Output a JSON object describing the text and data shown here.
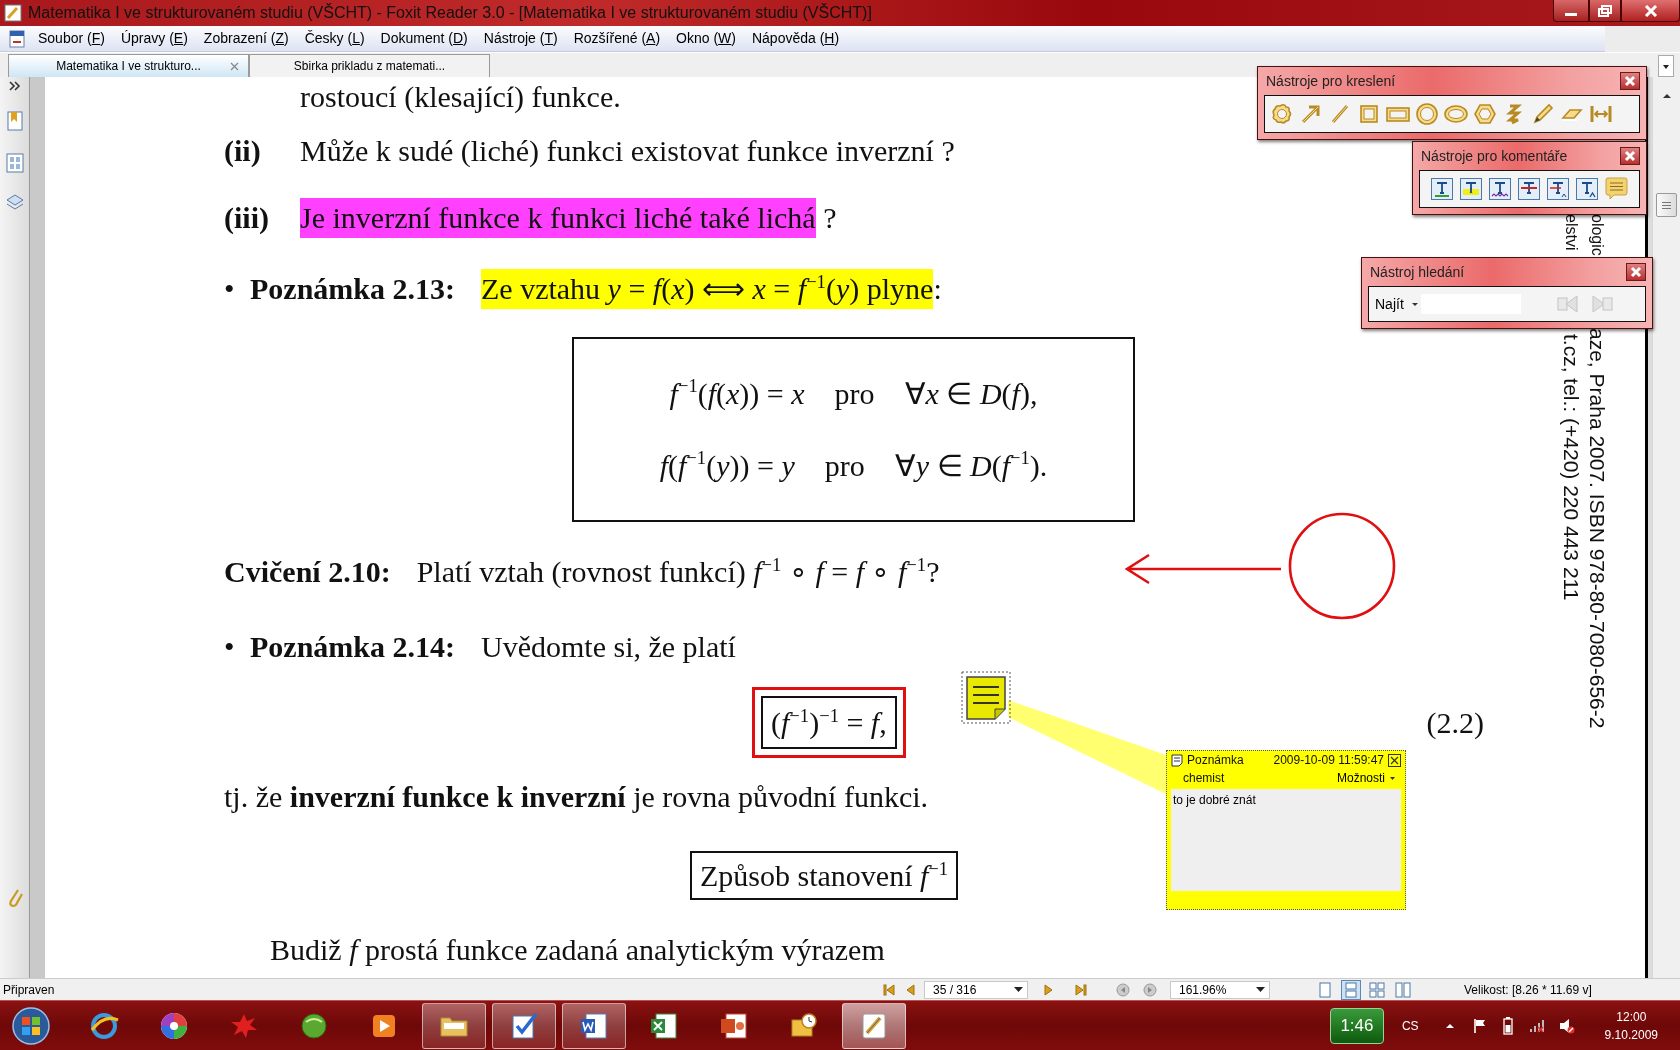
{
  "window": {
    "title": "Matematika I ve strukturovaném studiu (VŠCHT) - Foxit Reader 3.0 - [Matematika I ve strukturovaném studiu (VŠCHT)]"
  },
  "menu": [
    {
      "before": "Soubor (",
      "key": "F",
      "after": ")"
    },
    {
      "before": "Úpravy (",
      "key": "E",
      "after": ")"
    },
    {
      "before": "Zobrazení (",
      "key": "Z",
      "after": ")"
    },
    {
      "before": "Česky (",
      "key": "L",
      "after": ")"
    },
    {
      "before": "Dokument (",
      "key": "D",
      "after": ")"
    },
    {
      "before": "Nástroje (",
      "key": "T",
      "after": ")"
    },
    {
      "before": "Rozšířené (",
      "key": "A",
      "after": ")"
    },
    {
      "before": "Okno (",
      "key": "W",
      "after": ")"
    },
    {
      "before": "Nápověda (",
      "key": "H",
      "after": ")"
    }
  ],
  "tabs": [
    {
      "label": "Matematika I ve strukturo...",
      "selected": true
    },
    {
      "label": "Sbirka prikladu z matemati...",
      "selected": false
    }
  ],
  "document": {
    "cut_line": "rostoucí (klesající) funkce.",
    "questions": [
      {
        "label": "(ii)",
        "segments": [
          {
            "text": "Může k sudé (liché) funkci existovat funkce inverzní ?"
          }
        ]
      },
      {
        "label": "(iii)",
        "segments": [
          {
            "text": "Je inverzní funkce k funkci liché také lichá",
            "color": "#ff40ff"
          },
          {
            "text": " ?"
          }
        ]
      }
    ],
    "remark_1": {
      "bullet": "•",
      "title": "Poznámka 2.13:",
      "segments": [
        {
          "text": "Ze vztahu *y* = *f*(*x*) ⟺ *x* = *f*$^{−1}$(*y*) plyne",
          "color": "#ffff00"
        },
        {
          "text": ":"
        }
      ]
    },
    "formula_box": [
      {
        "lhs": "*f*$^{−1}$(*f*(*x*)) = *x*",
        "word": "pro",
        "rhs": "∀*x* ∈ *D*(*f*),"
      },
      {
        "lhs": "*f*(*f*$^{−1}$(*y*)) = *y*",
        "word": "pro",
        "rhs": "∀*y* ∈ *D*(*f*$^{−1}$)."
      }
    ],
    "exercise": {
      "title": "Cvičení 2.10:",
      "text": "Platí vztah (rovnost funkcí) *f*$^{−1}$ ∘ *f* = *f* ∘ *f*$^{−1}$?"
    },
    "remark_2": {
      "bullet": "•",
      "title": "Poznámka 2.14:",
      "text": "Uvědomte si, že platí"
    },
    "equation": {
      "formula": "(*f*$^{−1}$)$^{−1}$ = *f*,",
      "number": "(2.2)"
    },
    "sentence": "tj. že **inverzní funkce k inverzní** je rovna původní funkci.",
    "heading": "Způsob stanovení *f*$^{−1}$",
    "last_line": "Budiž *f* prostá funkce zadaná analytickým výrazem",
    "side_text": [
      {
        "parts": [
          "elstvi",
          "t.cz, tel.: (+420) 220 443 211"
        ]
      },
      {
        "parts": [
          "ologic",
          "aze, Praha 2007. ISBN 978-80-7080-656-2"
        ]
      }
    ]
  },
  "note": {
    "title": "Poznámka",
    "date": "2009-10-09 11:59:47",
    "author": "chemist",
    "options": "Možnosti",
    "text": "to je dobré znát"
  },
  "panels": {
    "drawing": {
      "title": "Nástroje pro kreslení"
    },
    "comments": {
      "title": "Nástroje pro komentáře"
    },
    "search": {
      "title": "Nástroj hledání",
      "label": "Najít",
      "nav_disabled": true
    }
  },
  "status_bar": {
    "text": "Připraven",
    "page": "35 / 316",
    "zoom": "161.96%",
    "views": [
      {
        "selected": false
      },
      {
        "selected": true
      },
      {
        "selected": false
      },
      {
        "selected": false
      }
    ],
    "size": "Velikost: [8.26 * 11.69 v]"
  },
  "taskbar": {
    "apps": [
      {
        "running": false,
        "active": false
      },
      {
        "running": false,
        "active": false
      },
      {
        "running": false,
        "active": false
      },
      {
        "running": false,
        "active": false
      },
      {
        "running": false,
        "active": false
      },
      {
        "running": true,
        "active": false
      },
      {
        "running": true,
        "active": false
      },
      {
        "running": true,
        "active": false
      },
      {
        "running": false,
        "active": false
      },
      {
        "running": false,
        "active": false
      },
      {
        "running": false,
        "active": false
      },
      {
        "running": true,
        "active": true
      }
    ],
    "gadget": "1:46",
    "language": "CS",
    "time": "12:00",
    "date": "9.10.2009"
  }
}
